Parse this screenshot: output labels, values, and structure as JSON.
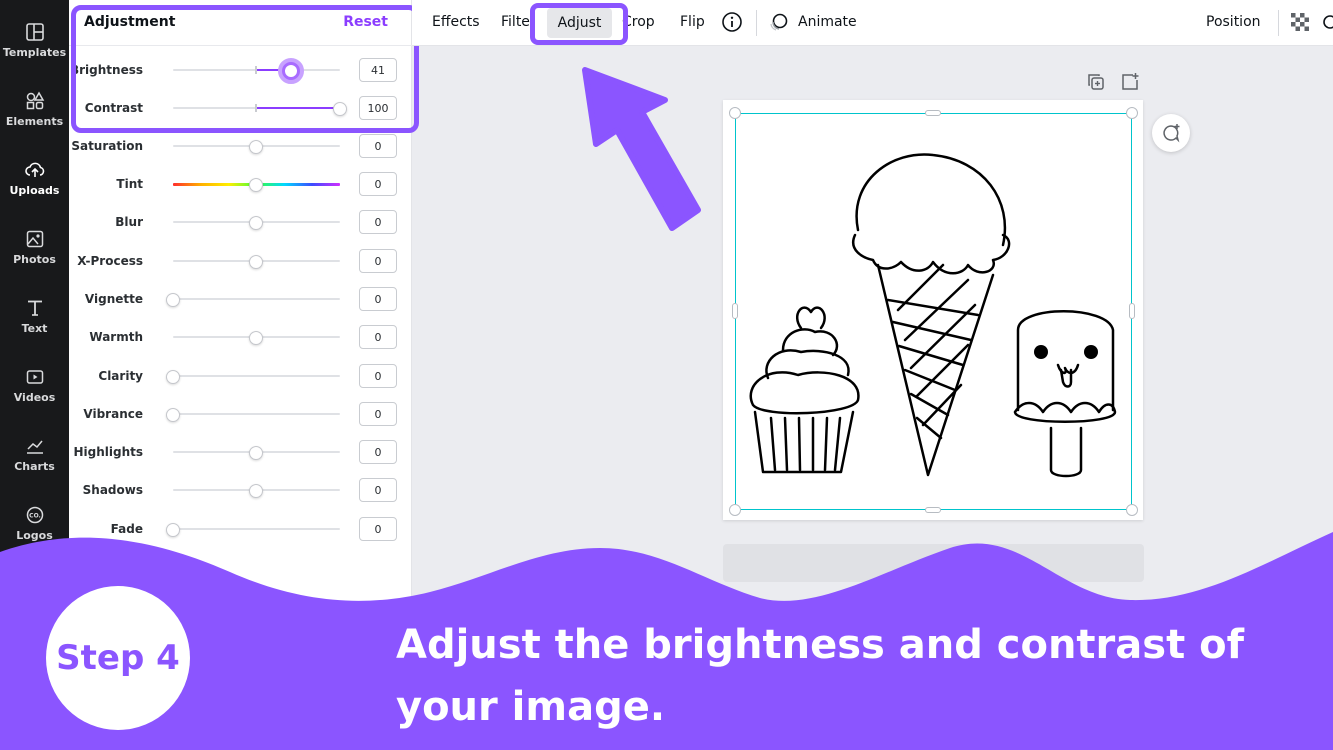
{
  "rail": {
    "items": [
      {
        "label": "Templates",
        "icon": "templates-icon"
      },
      {
        "label": "Elements",
        "icon": "elements-icon"
      },
      {
        "label": "Uploads",
        "icon": "upload-icon"
      },
      {
        "label": "Photos",
        "icon": "photos-icon"
      },
      {
        "label": "Text",
        "icon": "text-icon"
      },
      {
        "label": "Videos",
        "icon": "videos-icon"
      },
      {
        "label": "Charts",
        "icon": "charts-icon"
      },
      {
        "label": "Logos",
        "icon": "logos-icon"
      }
    ]
  },
  "panel": {
    "title": "Adjustment",
    "reset_label": "Reset",
    "sliders": [
      {
        "label": "Brightness",
        "value": "41"
      },
      {
        "label": "Contrast",
        "value": "100"
      },
      {
        "label": "Saturation",
        "value": "0"
      },
      {
        "label": "Tint",
        "value": "0"
      },
      {
        "label": "Blur",
        "value": "0"
      },
      {
        "label": "X-Process",
        "value": "0"
      },
      {
        "label": "Vignette",
        "value": "0"
      },
      {
        "label": "Warmth",
        "value": "0"
      },
      {
        "label": "Clarity",
        "value": "0"
      },
      {
        "label": "Vibrance",
        "value": "0"
      },
      {
        "label": "Highlights",
        "value": "0"
      },
      {
        "label": "Shadows",
        "value": "0"
      },
      {
        "label": "Fade",
        "value": "0"
      }
    ]
  },
  "toolbar": {
    "effects": "Effects",
    "filter": "Filte",
    "adjust": "Adjust",
    "crop": "Crop",
    "flip": "Flip",
    "animate": "Animate",
    "position": "Position"
  },
  "banner": {
    "step": "Step 4",
    "caption_line1": "Adjust the brightness and contrast of",
    "caption_line2": "your image."
  },
  "colors": {
    "accent": "#8b55ff",
    "rail_bg": "#18191b",
    "selection": "#00c4cc"
  }
}
